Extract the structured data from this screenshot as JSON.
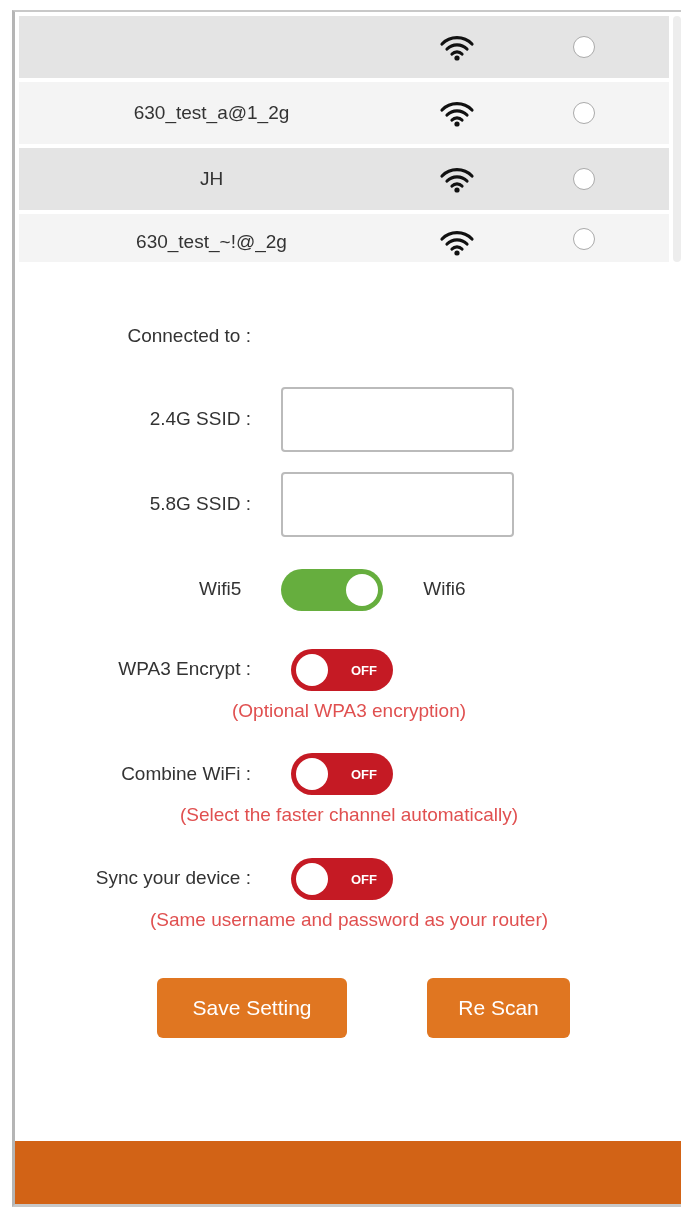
{
  "networks": [
    {
      "selected": false
    },
    {
      "name": "630_test_a@1_2g",
      "selected": false
    },
    {
      "name": "JH",
      "selected": false
    },
    {
      "name": "630_test_~!@_2g",
      "selected": false
    }
  ],
  "connected_label": "Connected to :",
  "ssid_fields": [
    {
      "label": "2.4G SSID :"
    },
    {
      "label": "5.8G SSID :"
    }
  ],
  "wifi_mode": {
    "left_label": "Wifi5",
    "right_label": "Wifi6",
    "on": true
  },
  "options": [
    {
      "label": "WPA3 Encrypt :",
      "on": false,
      "state_text": "OFF",
      "hint": "(Optional WPA3 encryption)"
    },
    {
      "label": "Combine WiFi :",
      "on": false,
      "state_text": "OFF",
      "hint": "(Select the faster channel automatically)"
    },
    {
      "label": "Sync your device :",
      "on": false,
      "state_text": "OFF",
      "hint": "(Same username and password as your router)"
    }
  ],
  "buttons": [
    "Save Setting",
    "Re Scan"
  ]
}
